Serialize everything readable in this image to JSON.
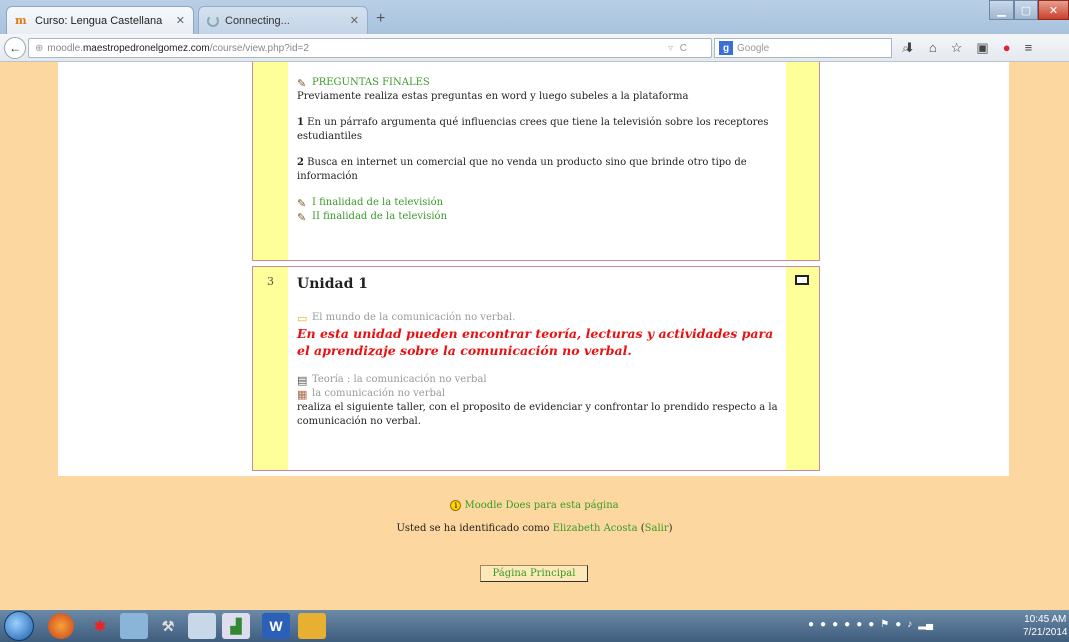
{
  "browser": {
    "tabs": [
      {
        "label": "Curso: Lengua Castellana",
        "favicon": "moodle-icon",
        "active": true
      },
      {
        "label": "Connecting...",
        "favicon": "loading-icon",
        "active": false
      }
    ],
    "new_tab": "+",
    "url": {
      "prefix": "moodle.",
      "host": "maestropedronelgomez.com",
      "path": "/course/view.php?id=2"
    },
    "search_placeholder": "Google"
  },
  "section_top": {
    "activity_title": "PREGUNTAS FINALES",
    "intro": "Previamente realiza estas preguntas en word y luego subeles a la plataforma",
    "q1_num": "1",
    "q1_text": "En un párrafo argumenta qué influencias crees que tiene la televisión sobre los receptores estudiantiles",
    "q2_num": "2",
    "q2_text": "Busca en internet un comercial que no venda un producto sino que brinde otro tipo de información",
    "link1": "I finalidad de la televisión",
    "link2": "II finalidad de la televisión"
  },
  "section_3": {
    "number": "3",
    "title": "Unidad 1",
    "folder_link": "El mundo de la comunicación no verbal.",
    "summary": "En esta unidad pueden encontrar teoría, lecturas y actividades para el aprendizaje sobre la comunicación no verbal.",
    "resource_link": "Teoría : la comunicación no verbal",
    "assignment_link": "la comunicación no verbal",
    "description": "realiza el siguiente taller, con el proposito de evidenciar y confrontar  lo prendido respecto a la comunicación no verbal."
  },
  "footer": {
    "docs_link": "Moodle Does para esta página",
    "login_prefix": "Usted se ha identificado como",
    "user_name": "Elizabeth Acosta",
    "logout": "Salir",
    "home_button": "Página Principal"
  },
  "taskbar": {
    "time": "10:45 AM",
    "date": "7/21/2014"
  },
  "colors": {
    "page_bg": "#fcd8a0",
    "side_yellow": "#ffff99",
    "link_green": "#3a9a2a",
    "summary_red": "#e81010"
  }
}
